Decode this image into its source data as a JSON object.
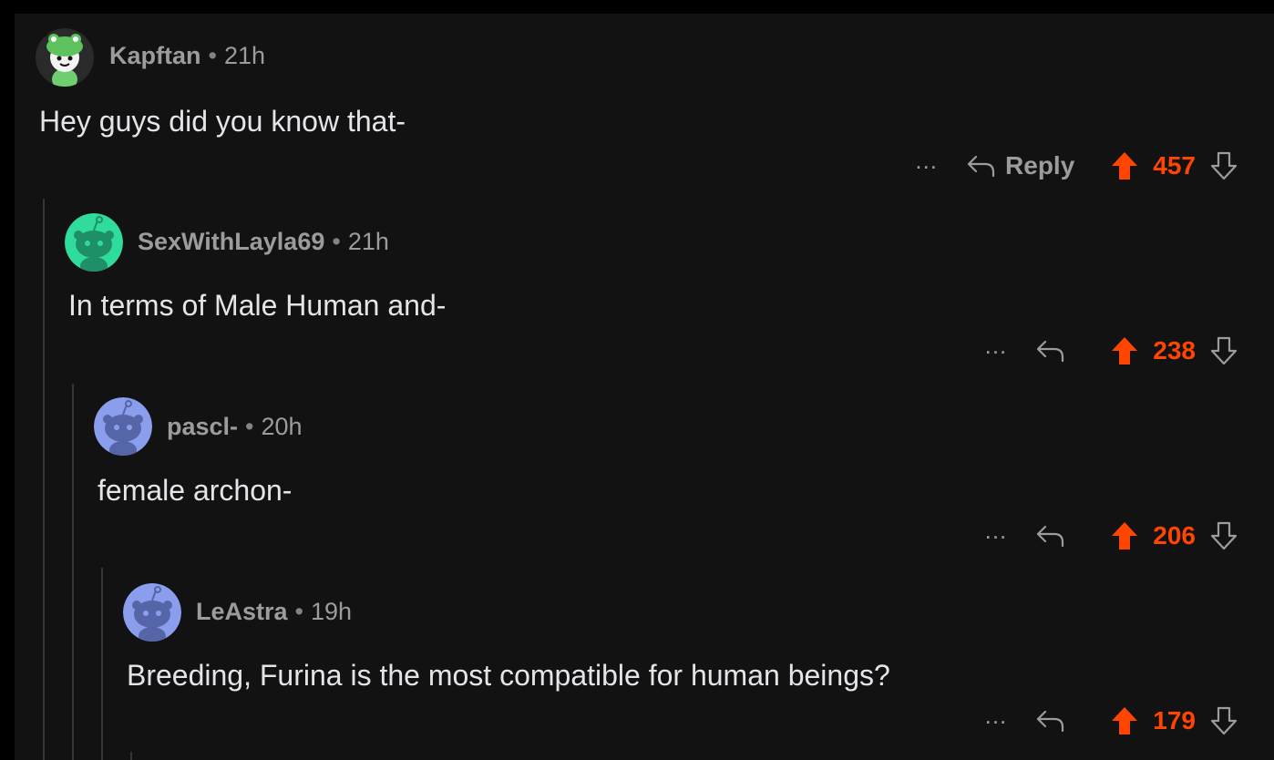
{
  "comments": [
    {
      "author": "Kapftan",
      "separator": "•",
      "time": "21h",
      "body": "Hey guys did you know that-",
      "more": "...",
      "reply_label": "Reply",
      "score": "457",
      "avatar_color": "#6fcf70"
    },
    {
      "author": "SexWithLayla69",
      "separator": "•",
      "time": "21h",
      "body": "In terms of Male Human and-",
      "more": "...",
      "score": "238",
      "avatar_color": "#2fdc9c"
    },
    {
      "author": "pascl-",
      "separator": "•",
      "time": "20h",
      "body": "female archon-",
      "more": "...",
      "score": "206",
      "avatar_color": "#8a9eed"
    },
    {
      "author": "LeAstra",
      "separator": "•",
      "time": "19h",
      "body": "Breeding, Furina is the most compatible for human beings?",
      "more": "...",
      "score": "179",
      "avatar_color": "#8a9eed"
    }
  ],
  "colors": {
    "upvote": "#ff4500",
    "background": "#121212",
    "thread_line": "#343536"
  },
  "icons": {
    "reply": "reply-arrow-icon",
    "upvote": "upvote-arrow-icon",
    "downvote": "downvote-arrow-icon",
    "more": "more-options-icon"
  }
}
